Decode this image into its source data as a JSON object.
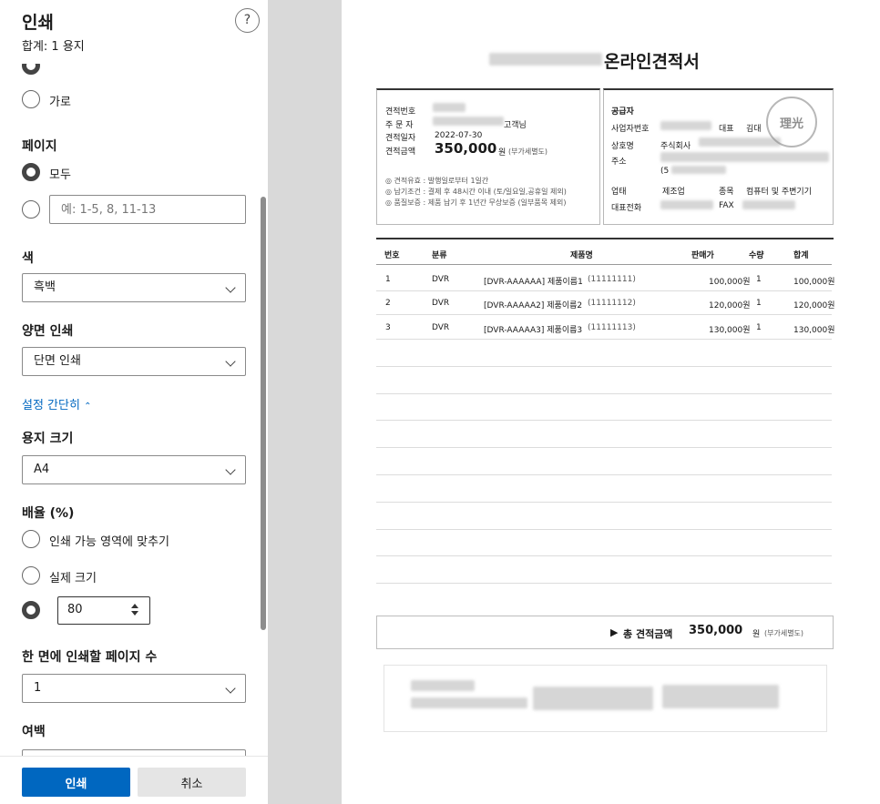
{
  "panel": {
    "title": "인쇄",
    "subtitle": "합계: 1 용지",
    "help": "?",
    "orientation": {
      "landscape": "가로"
    },
    "pages": {
      "label": "페이지",
      "all": "모두",
      "custom_placeholder": "예: 1-5, 8, 11-13"
    },
    "color": {
      "label": "색",
      "value": "흑백"
    },
    "duplex": {
      "label": "양면 인쇄",
      "value": "단면 인쇄"
    },
    "less_settings": "설정 간단히",
    "paper_size": {
      "label": "용지 크기",
      "value": "A4"
    },
    "scale": {
      "label": "배율 (%)",
      "fit": "인쇄 가능 영역에 맞추기",
      "actual": "실제 크기",
      "custom_value": "80"
    },
    "pages_per_sheet": {
      "label": "한 면에 인쇄할 페이지 수",
      "value": "1"
    },
    "margins": {
      "label": "여백"
    },
    "buttons": {
      "print": "인쇄",
      "cancel": "취소"
    }
  },
  "doc": {
    "title": "온라인견적서",
    "left": {
      "quote_no_label": "견적번호",
      "orderer_label": "주 문 자",
      "customer_suffix": "고객님",
      "date_label": "견적일자",
      "date": "2022-07-30",
      "amount_label": "견적금액",
      "amount": "350,000",
      "amount_unit": "원",
      "vat": "(부가세별도)",
      "notes": [
        "◎ 견적유효 : 발행일로부터 1일간",
        "◎ 납기조건 : 결제 후 48시간 이내 (토/일요일,공휴일 제외)",
        "◎ 품질보증 : 제품 납기 후 1년간 무상보증 (일부품목 제외)"
      ]
    },
    "supplier": {
      "title": "공급자",
      "biz_no_label": "사업자번호",
      "rep_label": "대표",
      "rep_value": "김대",
      "company_label": "상호명",
      "company_value": "주식회사",
      "address_label": "주소",
      "address_prefix": "(5",
      "business_label": "업태",
      "business_value": "제조업",
      "item_label": "종목",
      "item_value": "컴퓨터 및 주변기기",
      "phone_label": "대표전화",
      "fax_label": "FAX",
      "seal": "理光"
    },
    "table": {
      "headers": [
        "번호",
        "분류",
        "제품명",
        "판매가",
        "수량",
        "합계"
      ],
      "rows": [
        {
          "no": "1",
          "cat": "DVR",
          "name": "[DVR-AAAAAA] 제품이름1",
          "code": "(11111111)",
          "price": "100,000원",
          "qty": "1",
          "total": "100,000원"
        },
        {
          "no": "2",
          "cat": "DVR",
          "name": "[DVR-AAAAA2] 제품이름2",
          "code": "(11111112)",
          "price": "120,000원",
          "qty": "1",
          "total": "120,000원"
        },
        {
          "no": "3",
          "cat": "DVR",
          "name": "[DVR-AAAAA3] 제품이름3",
          "code": "(11111113)",
          "price": "130,000원",
          "qty": "1",
          "total": "130,000원"
        }
      ]
    },
    "total": {
      "label": "총 견적금액",
      "amount": "350,000",
      "unit": "원",
      "vat": "(부가세별도)"
    }
  }
}
